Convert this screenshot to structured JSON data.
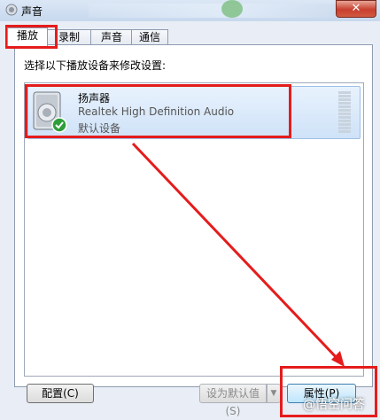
{
  "window": {
    "title": "声音",
    "close_label": "✕"
  },
  "tabs": [
    {
      "label": "播放"
    },
    {
      "label": "录制"
    },
    {
      "label": "声音"
    },
    {
      "label": "通信"
    }
  ],
  "instruction": "选择以下播放设备来修改设置:",
  "device": {
    "name": "扬声器",
    "description": "Realtek High Definition Audio",
    "status": "默认设备"
  },
  "buttons": {
    "configure": "配置(C)",
    "set_default": "设为默认值(S)",
    "dropdown": "▼",
    "properties": "属性(P)"
  },
  "watermark": "@悟空问答",
  "colors": {
    "annotation": "#e51c1c"
  }
}
